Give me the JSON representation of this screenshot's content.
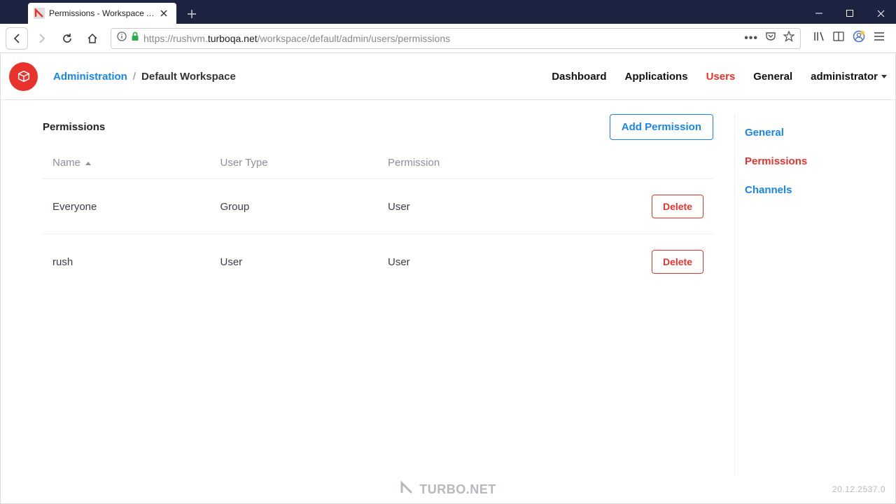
{
  "browser": {
    "tab_title": "Permissions - Workspace Admi",
    "url_host": "turboqa.net",
    "url_prefix": "https://rushvm.",
    "url_path": "/workspace/default/admin/users/permissions"
  },
  "header": {
    "breadcrumb_link": "Administration",
    "breadcrumb_sep": "/",
    "breadcrumb_current": "Default Workspace",
    "nav": {
      "dashboard": "Dashboard",
      "applications": "Applications",
      "users": "Users",
      "general": "General",
      "user_menu": "administrator"
    }
  },
  "page": {
    "title": "Permissions",
    "add_button": "Add Permission",
    "table": {
      "columns": {
        "name": "Name",
        "user_type": "User Type",
        "permission": "Permission"
      },
      "rows": [
        {
          "name": "Everyone",
          "user_type": "Group",
          "permission": "User",
          "delete": "Delete"
        },
        {
          "name": "rush",
          "user_type": "User",
          "permission": "User",
          "delete": "Delete"
        }
      ]
    }
  },
  "sidebar": {
    "general": "General",
    "permissions": "Permissions",
    "channels": "Channels"
  },
  "footer": {
    "brand": "TURBO.NET",
    "version": "20.12.2537.0"
  }
}
